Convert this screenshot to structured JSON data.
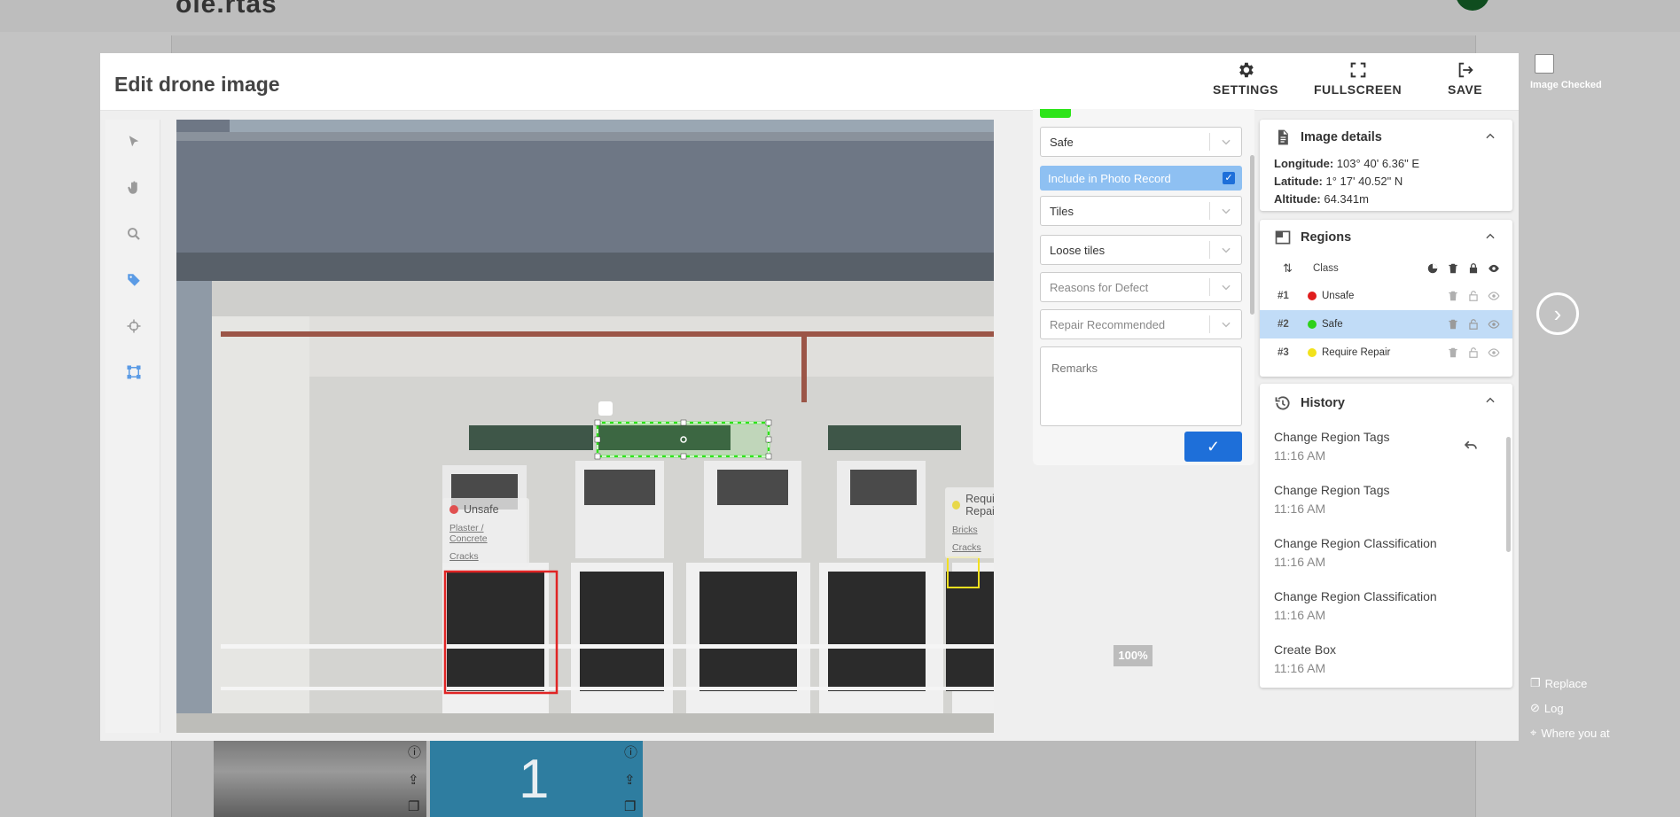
{
  "background": {
    "logo": "ole.rtas",
    "thumbnail_number": "1"
  },
  "modal": {
    "title": "Edit drone image",
    "settings_label": "SETTINGS",
    "fullscreen_label": "FULLSCREEN",
    "save_label": "SAVE"
  },
  "canvas": {
    "zoom": "100%",
    "regions": [
      {
        "class": "Unsafe",
        "color": "#e02424",
        "tags": [
          "Plaster / Concrete",
          "Cracks"
        ]
      },
      {
        "class": "Require Repair",
        "color": "#f2e01f",
        "tags": [
          "Bricks",
          "Cracks"
        ]
      }
    ]
  },
  "editor": {
    "classification": "Safe",
    "include_photo_record": "Include in Photo Record",
    "element": "Tiles",
    "defect": "Loose tiles",
    "reasons_placeholder": "Reasons for Defect",
    "repair_placeholder": "Repair Recommended",
    "remarks_placeholder": "Remarks"
  },
  "image_details": {
    "title": "Image details",
    "longitude_label": "Longitude:",
    "longitude": "103° 40' 6.36\" E",
    "latitude_label": "Latitude:",
    "latitude": "1° 17' 40.52\" N",
    "altitude_label": "Altitude:",
    "altitude": "64.341m"
  },
  "regions": {
    "title": "Regions",
    "class_header": "Class",
    "rows": [
      {
        "num": "#1",
        "label": "Unsafe",
        "color": "#e01d1d"
      },
      {
        "num": "#2",
        "label": "Safe",
        "color": "#2fd11a"
      },
      {
        "num": "#3",
        "label": "Require Repair",
        "color": "#f2e21c"
      }
    ]
  },
  "history": {
    "title": "History",
    "items": [
      {
        "title": "Change Region Tags",
        "time": "11:16 AM"
      },
      {
        "title": "Change Region Tags",
        "time": "11:16 AM"
      },
      {
        "title": "Change Region Classification",
        "time": "11:16 AM"
      },
      {
        "title": "Change Region Classification",
        "time": "11:16 AM"
      },
      {
        "title": "Create Box",
        "time": "11:16 AM"
      }
    ]
  },
  "side": {
    "image_checked": "Image Checked",
    "replace": "Replace",
    "log": "Log",
    "where": "Where you at"
  }
}
